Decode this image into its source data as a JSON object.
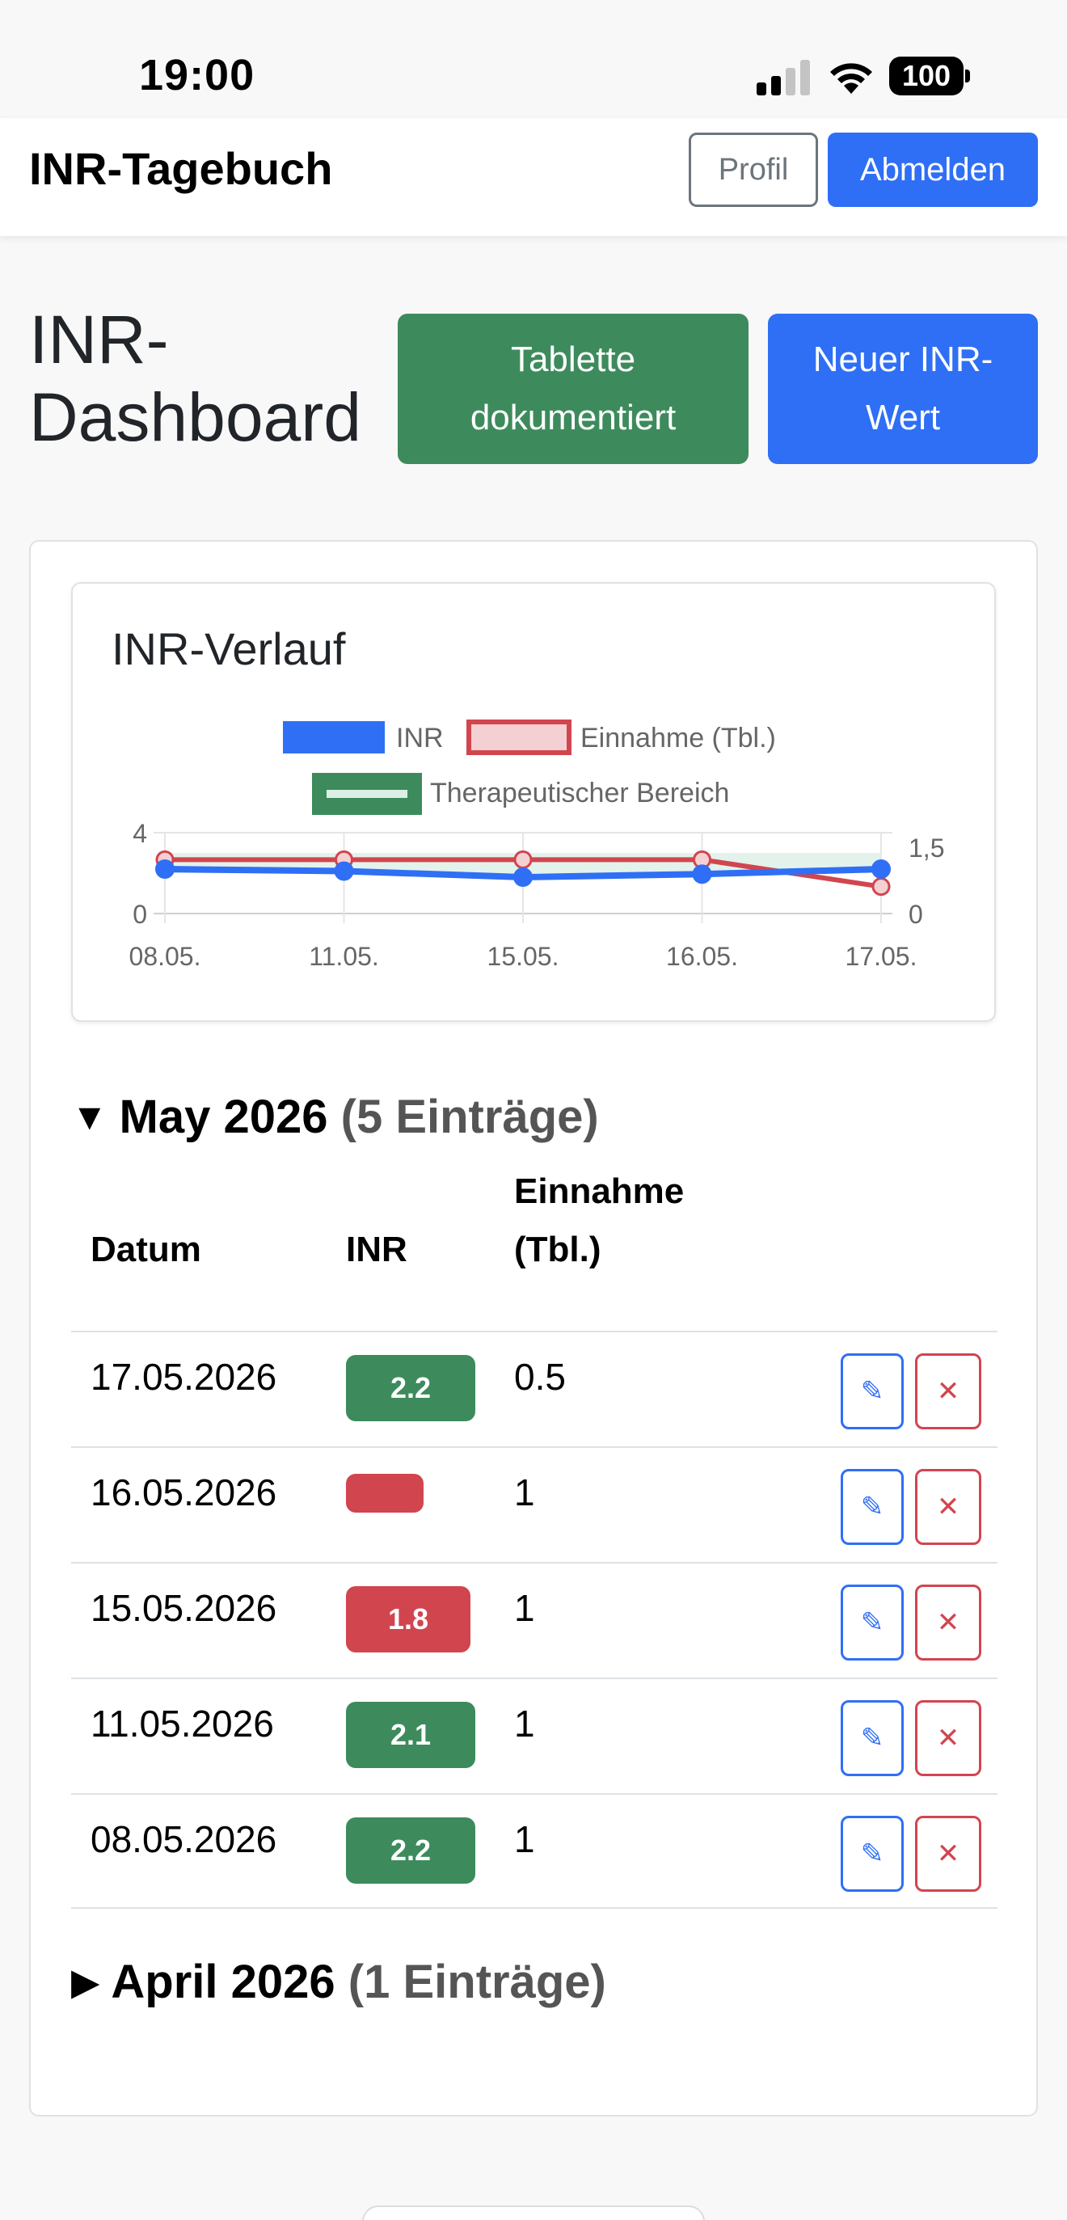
{
  "status_bar": {
    "time": "19:00",
    "battery": "100"
  },
  "navbar": {
    "brand": "INR-Tagebuch",
    "profil_label": "Profil",
    "abmelden_label": "Abmelden"
  },
  "header": {
    "title": "INR-Dashboard",
    "tablette_label": "Tablette dokumentiert",
    "neuer_label": "Neuer INR-Wert"
  },
  "chart": {
    "title": "INR-Verlauf",
    "legend": [
      "INR",
      "Einnahme (Tbl.)",
      "Therapeutischer Bereich"
    ],
    "colors": {
      "inr": "#2f6ff5",
      "einnahme": "#d1454f",
      "range_fill": "#dcefe6",
      "range_border": "#3d8b5c"
    }
  },
  "chart_data": {
    "type": "line",
    "x": [
      "08.05.",
      "11.05.",
      "15.05.",
      "16.05.",
      "17.05."
    ],
    "series": [
      {
        "name": "INR",
        "axis": "left",
        "values": [
          2.2,
          2.1,
          1.8,
          1.95,
          2.2
        ]
      },
      {
        "name": "Einnahme (Tbl.)",
        "axis": "right",
        "values": [
          1,
          1,
          1,
          1,
          0.5
        ]
      },
      {
        "name": "Therapeutischer Bereich",
        "axis": "left",
        "range": [
          2,
          3
        ]
      }
    ],
    "y_left": {
      "ticks": [
        "0",
        "4"
      ],
      "lim": [
        0,
        4
      ]
    },
    "y_right": {
      "ticks": [
        "0",
        "1,5"
      ],
      "lim": [
        0,
        1.5
      ]
    },
    "grid": true,
    "legend_position": "top"
  },
  "table": {
    "headers": {
      "datum": "Datum",
      "inr": "INR",
      "einnahme": "Einnahme (Tbl.)"
    },
    "edit_icon": "✎",
    "delete_icon": "✕"
  },
  "months": [
    {
      "label": "May 2026",
      "count": "(5 Einträge)",
      "expanded": true,
      "rows": [
        {
          "date": "17.05.2026",
          "inr": "2.2",
          "inr_status": "green",
          "einnahme": "0.5"
        },
        {
          "date": "16.05.2026",
          "inr": "",
          "inr_status": "red",
          "einnahme": "1"
        },
        {
          "date": "15.05.2026",
          "inr": "1.8",
          "inr_status": "red",
          "einnahme": "1"
        },
        {
          "date": "11.05.2026",
          "inr": "2.1",
          "inr_status": "green",
          "einnahme": "1"
        },
        {
          "date": "08.05.2026",
          "inr": "2.2",
          "inr_status": "green",
          "einnahme": "1"
        }
      ]
    },
    {
      "label": "April 2026",
      "count": "(1 Einträge)",
      "expanded": false
    }
  ]
}
